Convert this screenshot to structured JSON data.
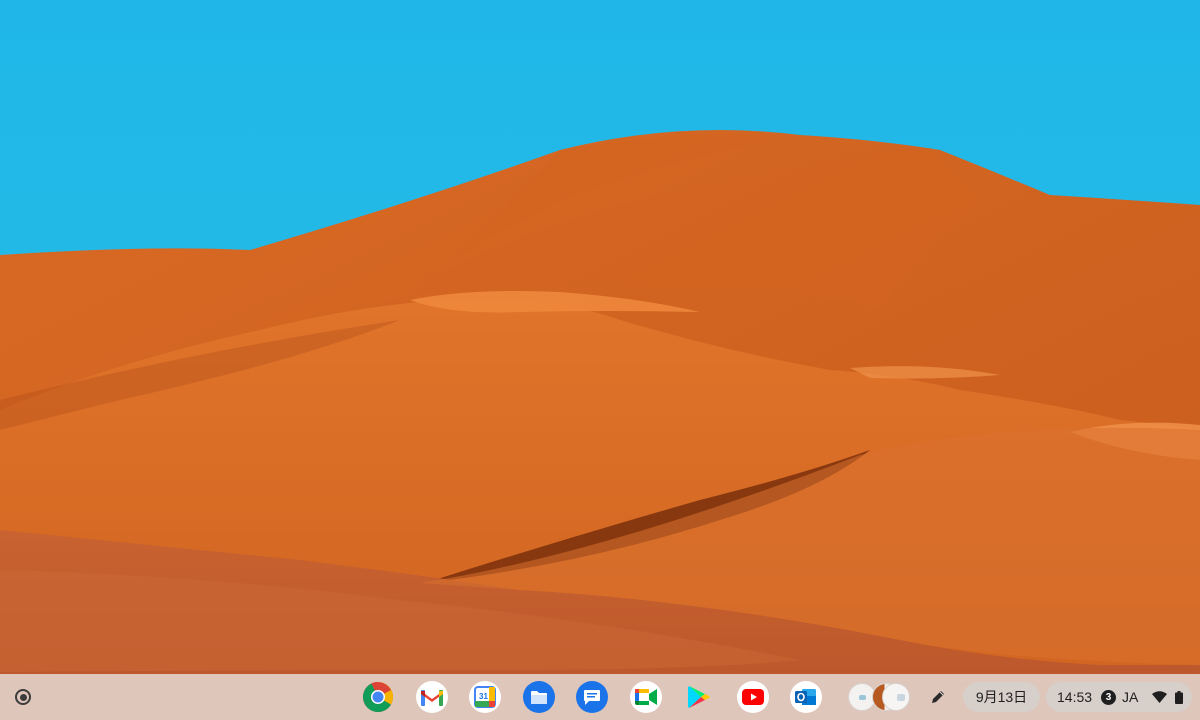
{
  "wallpaper": {
    "sky_color": "#1fb8e6",
    "dune_color": "#d9661f",
    "shadow_color": "#7a2f0c"
  },
  "shelf": {
    "launcher_icon": "launcher-circle-icon",
    "apps": [
      {
        "name": "Chrome",
        "icon": "chrome-icon"
      },
      {
        "name": "Gmail",
        "icon": "gmail-icon"
      },
      {
        "name": "Google Calendar",
        "icon": "calendar-icon",
        "label": "31"
      },
      {
        "name": "Files",
        "icon": "files-icon"
      },
      {
        "name": "Messages",
        "icon": "messages-icon"
      },
      {
        "name": "Google Meet",
        "icon": "meet-icon"
      },
      {
        "name": "Play Store",
        "icon": "play-store-icon"
      },
      {
        "name": "YouTube",
        "icon": "youtube-icon"
      },
      {
        "name": "Outlook",
        "icon": "outlook-icon"
      }
    ],
    "holding_space_icon": "holding-space-thumbnails",
    "stylus_icon": "stylus-pen-icon",
    "date": "9月13日",
    "time": "14:53",
    "notification_count": "3",
    "ime": "JA",
    "wifi_icon": "wifi-icon",
    "battery_icon": "battery-icon"
  }
}
